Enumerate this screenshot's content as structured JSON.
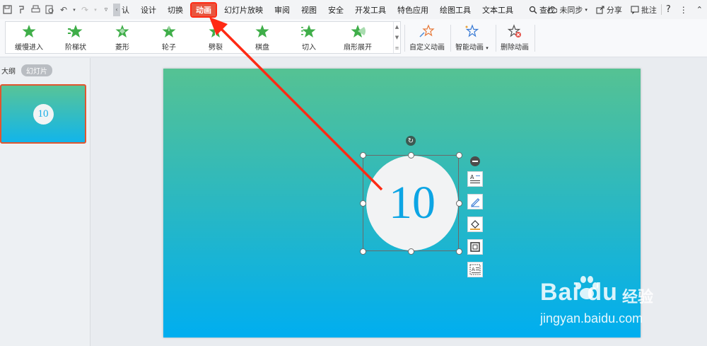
{
  "menubar": {
    "tabs": [
      {
        "label": "认"
      },
      {
        "label": "设计"
      },
      {
        "label": "切换"
      },
      {
        "label": "动画"
      },
      {
        "label": "幻灯片放映"
      },
      {
        "label": "审阅"
      },
      {
        "label": "视图"
      },
      {
        "label": "安全"
      },
      {
        "label": "开发工具"
      },
      {
        "label": "特色应用"
      },
      {
        "label": "绘图工具"
      },
      {
        "label": "文本工具"
      }
    ],
    "active_tab": "动画",
    "search_label": "查找",
    "sync_label": "未同步",
    "share_label": "分享",
    "comment_label": "批注",
    "help_glyph": "?",
    "more_glyph": "⋮",
    "collapse_glyph": "⌃"
  },
  "ribbon": {
    "gallery": [
      {
        "label": "缓慢进入"
      },
      {
        "label": "阶梯状"
      },
      {
        "label": "菱形"
      },
      {
        "label": "轮子"
      },
      {
        "label": "劈裂"
      },
      {
        "label": "棋盘"
      },
      {
        "label": "切入"
      },
      {
        "label": "扇形展开"
      }
    ],
    "custom_animation_label": "自定义动画",
    "smart_animation_label": "智能动画",
    "delete_animation_label": "删除动画",
    "star_color": "#3fae49"
  },
  "left_panel": {
    "outline_label": "大纲",
    "slides_label": "幻灯片",
    "thumbnail_number": "10"
  },
  "slide": {
    "number_text": "10",
    "gradient_top": "#55c293",
    "gradient_bottom": "#00aef0"
  },
  "watermark": {
    "logo": "Bai du",
    "logo_cn": "经验",
    "url": "jingyan.baidu.com"
  },
  "colors": {
    "accent": "#e8553e",
    "annotation": "#ff2a14"
  }
}
